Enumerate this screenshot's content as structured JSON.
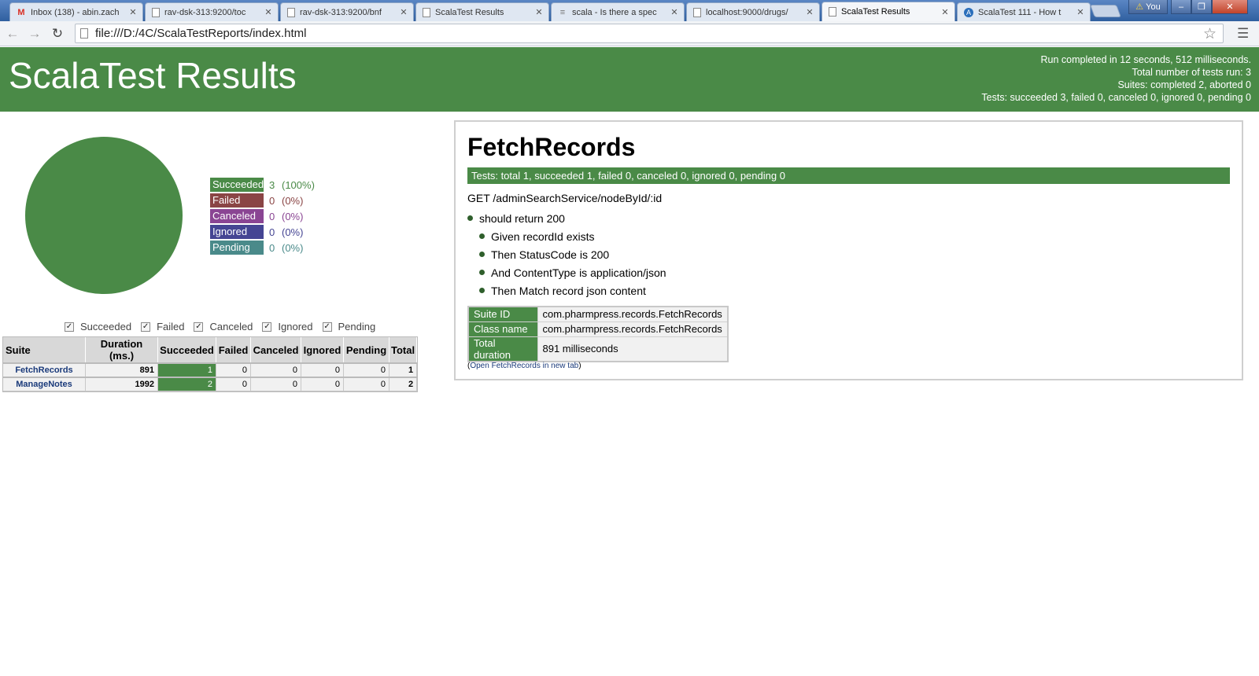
{
  "browser": {
    "tabs": [
      {
        "title": "Inbox (138) - abin.zach",
        "favicon": "gmail-icon",
        "active": false
      },
      {
        "title": "rav-dsk-313:9200/toc",
        "favicon": "document-icon",
        "active": false
      },
      {
        "title": "rav-dsk-313:9200/bnf",
        "favicon": "document-icon",
        "active": false
      },
      {
        "title": "ScalaTest Results",
        "favicon": "document-icon",
        "active": false
      },
      {
        "title": "scala - Is there a spec",
        "favicon": "stackoverflow-icon",
        "active": false
      },
      {
        "title": "localhost:9000/drugs/",
        "favicon": "document-icon",
        "active": false
      },
      {
        "title": "ScalaTest Results",
        "favicon": "document-icon",
        "active": true
      },
      {
        "title": "ScalaTest 111 - How t",
        "favicon": "a-circle-icon",
        "active": false
      }
    ],
    "close_glyph": "✕",
    "user_label": "You",
    "url": "file:///D:/4C/ScalaTestReports/index.html",
    "colors": {
      "tabstrip": "#3f6fb3",
      "toolbar": "#f1f3f6"
    }
  },
  "header": {
    "title": "ScalaTest Results",
    "summary": [
      "Run completed in 12 seconds, 512 milliseconds.",
      "Total number of tests run: 3",
      "Suites: completed 2, aborted 0",
      "Tests: succeeded 3, failed 0, canceled 0, ignored 0, pending 0"
    ],
    "color": "#4a8a47"
  },
  "chart_data": {
    "type": "pie",
    "slices": [
      {
        "label": "Succeeded",
        "value": 3,
        "color": "#4a8a47"
      },
      {
        "label": "Failed",
        "value": 0,
        "color": "#8a4545"
      },
      {
        "label": "Canceled",
        "value": 0,
        "color": "#8a4593"
      },
      {
        "label": "Ignored",
        "value": 0,
        "color": "#454593"
      },
      {
        "label": "Pending",
        "value": 0,
        "color": "#4a8a8a"
      }
    ]
  },
  "legend": [
    {
      "label": "Succeeded",
      "count": "3",
      "pct": "(100%)",
      "color": "#4a8a47"
    },
    {
      "label": "Failed",
      "count": "0",
      "pct": "(0%)",
      "color": "#8a4545"
    },
    {
      "label": "Canceled",
      "count": "0",
      "pct": "(0%)",
      "color": "#8a4593"
    },
    {
      "label": "Ignored",
      "count": "0",
      "pct": "(0%)",
      "color": "#454593"
    },
    {
      "label": "Pending",
      "count": "0",
      "pct": "(0%)",
      "color": "#4a8a8a"
    }
  ],
  "filters": [
    {
      "label": "Succeeded",
      "checked": true
    },
    {
      "label": "Failed",
      "checked": true
    },
    {
      "label": "Canceled",
      "checked": true
    },
    {
      "label": "Ignored",
      "checked": true
    },
    {
      "label": "Pending",
      "checked": true
    }
  ],
  "summary_table": {
    "headers": [
      "Suite",
      "Duration (ms.)",
      "Succeeded",
      "Failed",
      "Canceled",
      "Ignored",
      "Pending",
      "Total"
    ],
    "rows": [
      [
        "FetchRecords",
        "891",
        "1",
        "0",
        "0",
        "0",
        "0",
        "1"
      ],
      [
        "ManageNotes",
        "1992",
        "2",
        "0",
        "0",
        "0",
        "0",
        "2"
      ]
    ]
  },
  "detail": {
    "title": "FetchRecords",
    "tests_bar": "Tests: total 1, succeeded 1, failed 0, canceled 0, ignored 0, pending 0",
    "scope": "GET /adminSearchService/nodeById/:id",
    "test_name": "should return 200",
    "steps": [
      "Given recordId exists",
      "Then StatusCode is 200",
      "And ContentType is application/json",
      "Then Match record json content"
    ],
    "info": [
      {
        "key": "Suite ID",
        "value": "com.pharmpress.records.FetchRecords"
      },
      {
        "key": "Class name",
        "value": "com.pharmpress.records.FetchRecords"
      },
      {
        "key": "Total duration",
        "value": "891 milliseconds"
      }
    ],
    "open_link": {
      "prefix": "(",
      "text": "Open FetchRecords in new tab",
      "suffix": ")"
    }
  }
}
